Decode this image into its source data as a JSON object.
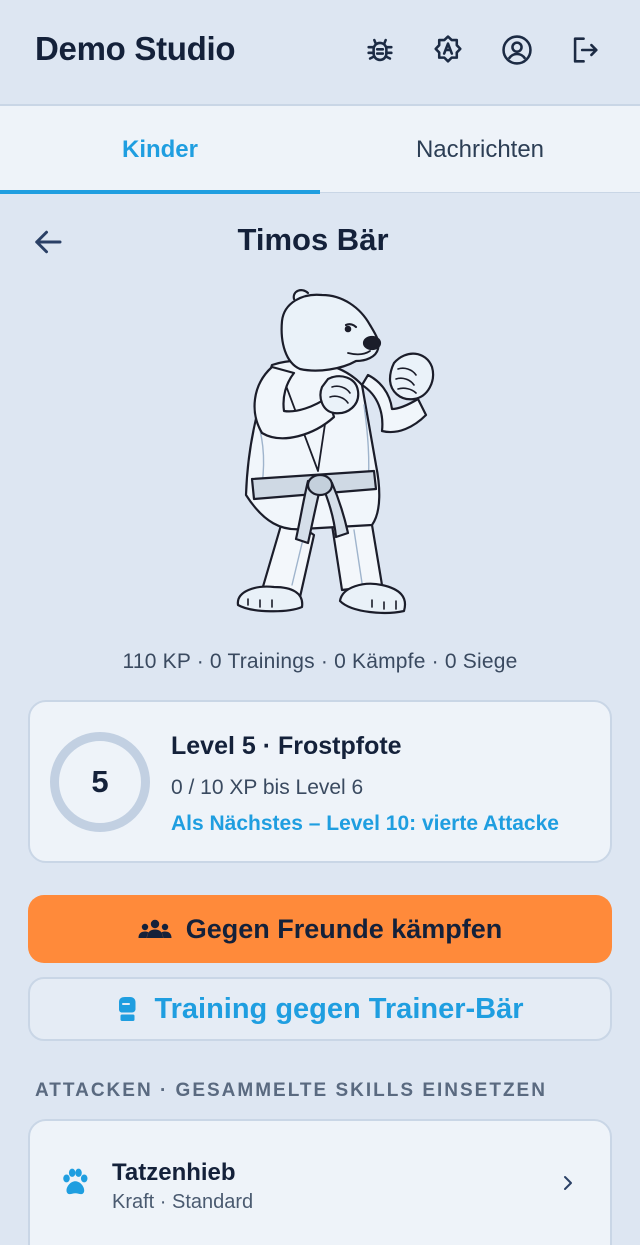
{
  "app": {
    "title": "Demo Studio"
  },
  "header_icons": [
    "bug-icon",
    "language-icon",
    "account-icon",
    "logout-icon"
  ],
  "tabs": [
    {
      "label": "Kinder",
      "active": true
    },
    {
      "label": "Nachrichten",
      "active": false
    }
  ],
  "page": {
    "title": "Timos Bär"
  },
  "stats": "110 KP · 0 Trainings · 0 Kämpfe · 0 Siege",
  "level": {
    "number": "5",
    "title": "Level 5 · Frostpfote",
    "xp": "0 / 10 XP bis Level 6",
    "next": "Als Nächstes – Level 10: vierte Attacke",
    "progress": 0
  },
  "actions": {
    "fight_label": "Gegen Freunde kämpfen",
    "train_label": "Training gegen Trainer-Bär"
  },
  "attacks": {
    "section_label": "ATTACKEN · GESAMMELTE SKILLS EINSETZEN",
    "items": [
      {
        "name": "Tatzenhieb",
        "sub": "Kraft · Standard"
      }
    ]
  },
  "colors": {
    "accent": "#1f9ee0",
    "background": "#dde6f2",
    "card": "#eef3f9",
    "fight_button": "#ff8a3a"
  }
}
